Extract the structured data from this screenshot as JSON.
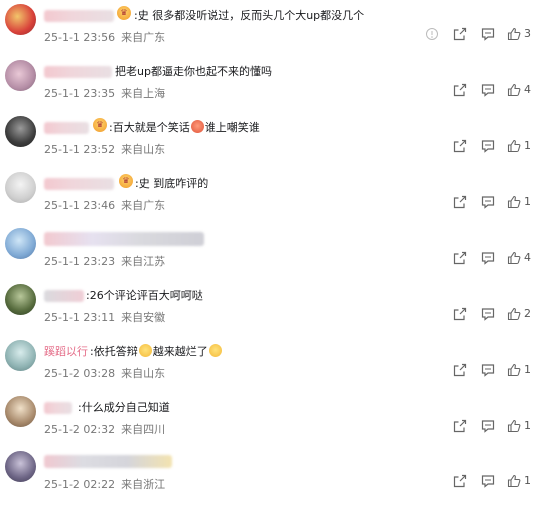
{
  "comments": [
    {
      "user": "",
      "content": ":史 很多都没听说过，反而头几个大up都没几个",
      "date": "25-1-1 23:56",
      "location": "来自广东",
      "likes": "3",
      "show_more": true
    },
    {
      "user": "",
      "content": "把老up都逼走你也起不来的懂吗",
      "date": "25-1-1 23:35",
      "location": "来自上海",
      "likes": "4"
    },
    {
      "user": "",
      "content": ":百大就是个笑话",
      "content2": "谁上嘲笑谁",
      "date": "25-1-1 23:52",
      "location": "来自山东",
      "likes": "1"
    },
    {
      "user": "",
      "content": ":史 到底咋评的",
      "date": "25-1-1 23:46",
      "location": "来自广东",
      "likes": "1"
    },
    {
      "user": "",
      "content": "",
      "date": "25-1-1 23:23",
      "location": "来自江苏",
      "likes": "4"
    },
    {
      "user": "",
      "content": ":26个评论评百大呵呵哒",
      "date": "25-1-1 23:11",
      "location": "来自安徽",
      "likes": "2"
    },
    {
      "user": "蹊蹈以行",
      "content": ":依托答辩",
      "content2": "越来越烂了",
      "date": "25-1-2 03:28",
      "location": "来自山东",
      "likes": "1"
    },
    {
      "user": "",
      "content": ":什么成分自己知道",
      "date": "25-1-2 02:32",
      "location": "来自四川",
      "likes": "1"
    },
    {
      "user": "",
      "content": "",
      "date": "25-1-2 02:22",
      "location": "来自浙江",
      "likes": "1"
    }
  ]
}
